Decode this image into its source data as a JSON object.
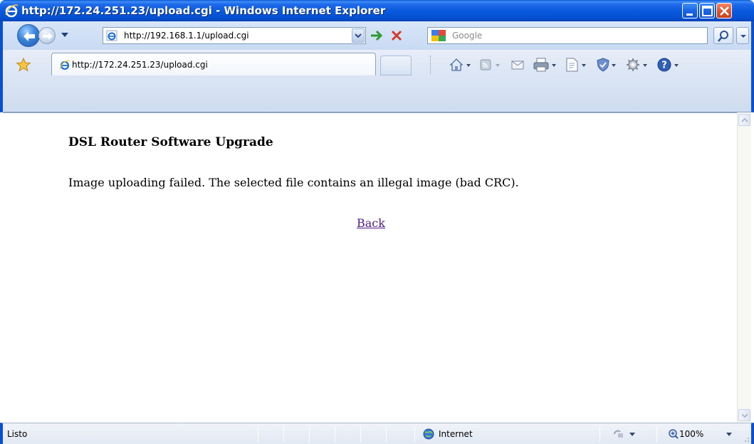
{
  "window": {
    "title": "http://172.24.251.23/upload.cgi - Windows Internet Explorer"
  },
  "address_bar": {
    "url": "http://192.168.1.1/upload.cgi",
    "search_placeholder": "Google"
  },
  "tab": {
    "label": "http://172.24.251.23/upload.cgi"
  },
  "page": {
    "heading": "DSL Router Software Upgrade",
    "message": "Image uploading failed. The selected file contains an illegal image (bad CRC).",
    "back_link": "Back"
  },
  "status_bar": {
    "status": "Listo",
    "zone": "Internet",
    "zoom": "100%"
  },
  "colors": {
    "titlebar": "#0758dc",
    "link_visited": "#551a8b"
  }
}
